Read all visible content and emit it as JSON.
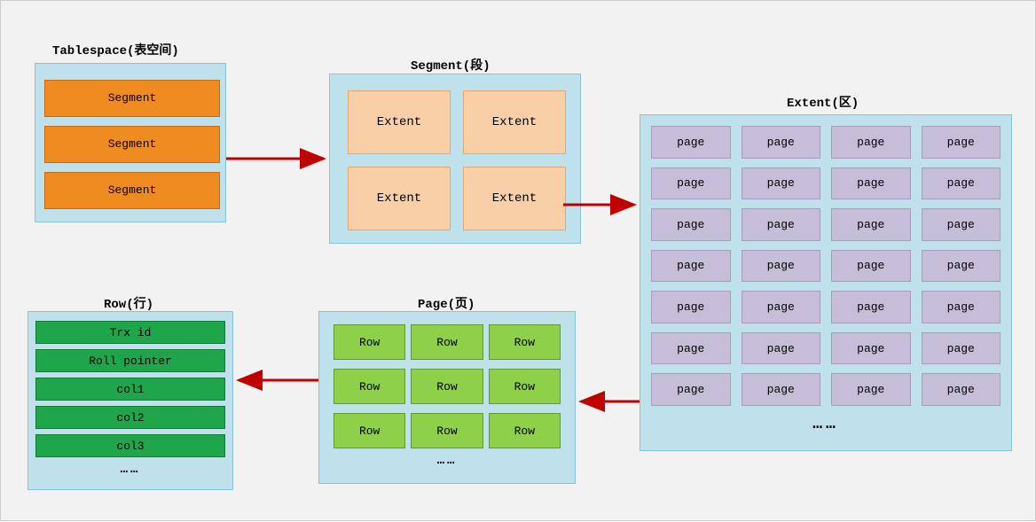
{
  "titles": {
    "tablespace": "Tablespace(表空间)",
    "segment": "Segment(段)",
    "extent": "Extent(区)",
    "page": "Page(页)",
    "row": "Row(行)"
  },
  "tablespace_items": [
    "Segment",
    "Segment",
    "Segment"
  ],
  "segment_items": [
    "Extent",
    "Extent",
    "Extent",
    "Extent"
  ],
  "page_label": "page",
  "row_label": "Row",
  "row_fields": [
    "Trx id",
    "Roll pointer",
    "col1",
    "col2",
    "col3"
  ],
  "ellipsis": "……"
}
